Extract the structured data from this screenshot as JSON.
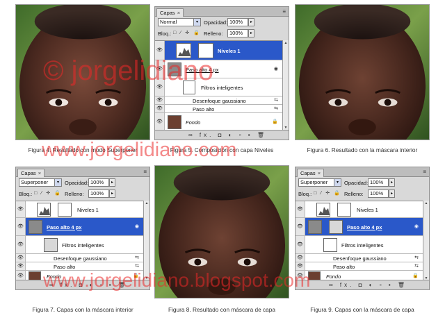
{
  "captions": {
    "fig4": "Figura 4. Resultado con modo Superponer",
    "fig5": "Figura 5. Composición con capa Niveles",
    "fig6": "Figura 6. Resultado con la máscara interior",
    "fig7": "Figura 7. Capas con la máscara interior",
    "fig8": "Figura 8. Resultado con máscara de capa",
    "fig9": "Figura 9. Capas con la máscara de capa"
  },
  "watermarks": {
    "copyright": "© jorgelidiano",
    "site1": "www.jorgelidiano.com",
    "site2": "www.jorgelidiano.blogspot.com"
  },
  "panel_common": {
    "tab_label": "Capas",
    "tab_close": "×",
    "menu_glyph": "≡",
    "opacity_label": "Opacidad:",
    "opacity_value": "100%",
    "lock_label": "Bloq.:",
    "fill_label": "Relleno:",
    "fill_value": "100%",
    "lock_icons": "□ ⁄ ✛ 🔒",
    "bottom_icons": "∞ fx. ◘ ◐ ▫ ▪ 🗑",
    "spin_glyph": "▸",
    "select_arrow": "▾",
    "eye_glyph": "👁",
    "fx_glyph": "fx",
    "scroll_up": "▲",
    "scroll_down": "▼"
  },
  "fig5_panel": {
    "blend_mode": "Normal",
    "layers": [
      {
        "name": "Niveles 1",
        "selected": true
      },
      {
        "name": "Paso alto 4 px",
        "selected": false
      },
      {
        "name": "Filtros inteligentes",
        "selected": false
      },
      {
        "name": "Desenfoque gaussiano",
        "selected": false
      },
      {
        "name": "Paso alto",
        "selected": false
      },
      {
        "name": "Fondo",
        "selected": false
      }
    ]
  },
  "fig7_panel": {
    "blend_mode": "Superponer",
    "layers": [
      {
        "name": "Niveles 1",
        "selected": false
      },
      {
        "name": "Paso alto 4 px",
        "selected": true
      },
      {
        "name": "Filtros inteligentes",
        "selected": false
      },
      {
        "name": "Desenfoque gaussiano",
        "selected": false
      },
      {
        "name": "Paso alto",
        "selected": false
      },
      {
        "name": "Fondo",
        "selected": false
      }
    ]
  },
  "fig9_panel": {
    "blend_mode": "Superponer",
    "layers": [
      {
        "name": "Niveles 1",
        "selected": false
      },
      {
        "name": "Paso alto 4 px",
        "selected": true
      },
      {
        "name": "Filtros inteligentes",
        "selected": false
      },
      {
        "name": "Desenfoque gaussiano",
        "selected": false
      },
      {
        "name": "Paso alto",
        "selected": false
      },
      {
        "name": "Fondo",
        "selected": false
      }
    ]
  },
  "colors": {
    "selected_layer": "#2a58c9",
    "panel_bg": "#d9d9d9",
    "watermark": "#eb2828"
  }
}
